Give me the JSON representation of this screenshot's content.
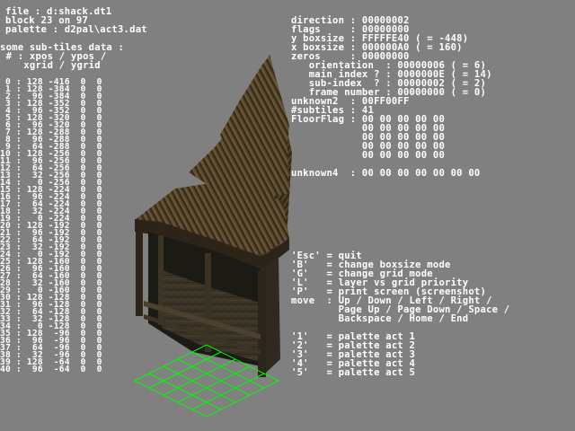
{
  "colors": {
    "background": "#808080",
    "text": "#ffffff",
    "grid": "#00ff00"
  },
  "header": {
    "file": "file : d:shack.dt1",
    "block": "block 23 on 97",
    "palette": "palette : d2pal\\act3.dat"
  },
  "subtiles": {
    "heading1": "some sub-tiles data :",
    "heading2": " # : xpos / ypos /",
    "heading3": "    xgrid / ygrid",
    "rows": [
      " 0 : 128 -416  0  0",
      " 1 : 128 -384  0  0",
      " 2 :  96 -384  0  0",
      " 3 : 128 -352  0  0",
      " 4 :  96 -352  0  0",
      " 5 : 128 -320  0  0",
      " 6 :  96 -320  0  0",
      " 7 : 128 -288  0  0",
      " 8 :  96 -288  0  0",
      " 9 :  64 -288  0  0",
      "10 : 128 -256  0  0",
      "11 :  96 -256  0  0",
      "12 :  64 -256  0  0",
      "13 :  32 -256  0  0",
      "14 :   0 -256  0  0",
      "15 : 128 -224  0  0",
      "16 :  96 -224  0  0",
      "17 :  64 -224  0  0",
      "18 :  32 -224  0  0",
      "19 :   0 -224  0  0",
      "20 : 128 -192  0  0",
      "21 :  96 -192  0  0",
      "22 :  64 -192  0  0",
      "23 :  32 -192  0  0",
      "24 :   0 -192  0  0",
      "25 : 128 -160  0  0",
      "26 :  96 -160  0  0",
      "27 :  64 -160  0  0",
      "28 :  32 -160  0  0",
      "29 :   0 -160  0  0",
      "30 : 128 -128  0  0",
      "31 :  96 -128  0  0",
      "32 :  64 -128  0  0",
      "33 :  32 -128  0  0",
      "34 :   0 -128  0  0",
      "35 : 128  -96  0  0",
      "36 :  96  -96  0  0",
      "37 :  64  -96  0  0",
      "38 :  32  -96  0  0",
      "39 : 128  -64  0  0",
      "40 :  96  -64  0  0"
    ]
  },
  "info": {
    "direction": "direction : 00000002",
    "flags": "flags     : 00000000",
    "y_boxsize": "y boxsize : FFFFFE40 ( = -448)",
    "x_boxsize": "x boxsize : 000000A0 ( = 160)",
    "zeros": "zeros     : 00000000",
    "orientation": "   orientation  : 00000006 ( = 6)",
    "main_index": "   main index ? : 0000000E ( = 14)",
    "sub_index": "   sub-index  ? : 00000002 ( = 2)",
    "frame_number": "   frame number : 00000000 ( = 0)",
    "unknown2": "unknown2  : 00FF00FF",
    "subtiles_count": "#subtiles : 41",
    "floorflag_1": "FloorFlag : 00 00 00 00 00",
    "floorflag_2": "            00 00 00 00 00",
    "floorflag_3": "            00 00 00 00 00",
    "floorflag_4": "            00 00 00 00 00",
    "floorflag_5": "            00 00 00 00 00",
    "unknown4": "unknown4  : 00 00 00 00 00 00 00"
  },
  "help": {
    "esc": "'Esc' = quit",
    "b": "'B'   = change boxsize mode",
    "g": "'G'   = change grid mode",
    "l": "'L'   = layer vs grid priority",
    "p": "'P'   = print screen (screenshot)",
    "move1": "move  : Up / Down / Left / Right /",
    "move2": "        Page Up / Page Down / Space /",
    "move3": "        Backspace / Home / End",
    "act1": "'1'   = palette act 1",
    "act2": "'2'   = palette act 2",
    "act3": "'3'   = palette act 3",
    "act4": "'4'   = palette act 4",
    "act5": "'5'   = palette act 5"
  }
}
